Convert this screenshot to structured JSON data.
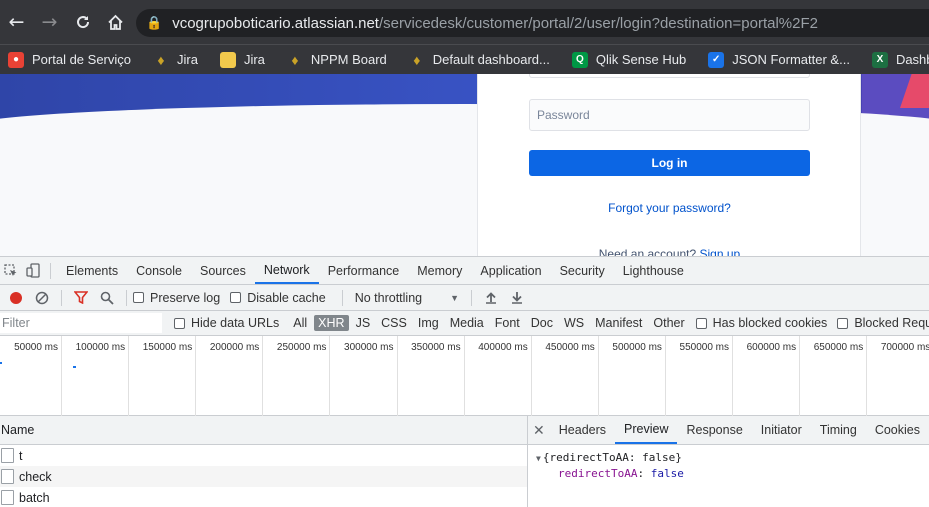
{
  "browser": {
    "url_host": "vcogrupoboticario.atlassian.net",
    "url_path": "/servicedesk/customer/portal/2/user/login?destination=portal%2F2"
  },
  "bookmarks": [
    {
      "label": "Portal de Serviço",
      "icon": "portal-icon",
      "color": "#e94235"
    },
    {
      "label": "Jira",
      "icon": "jira-icon",
      "color": "#c9a227"
    },
    {
      "label": "Jira",
      "icon": "folder-icon",
      "color": "#f2c94c"
    },
    {
      "label": "NPPM Board",
      "icon": "jira-icon",
      "color": "#c9a227"
    },
    {
      "label": "Default dashboard...",
      "icon": "jira-icon",
      "color": "#c9a227"
    },
    {
      "label": "Qlik Sense Hub",
      "icon": "qlik-icon",
      "color": "#009845"
    },
    {
      "label": "JSON Formatter &...",
      "icon": "check-icon",
      "color": "#1a73e8"
    },
    {
      "label": "Dashboard Realizad...",
      "icon": "excel-icon",
      "color": "#1d6f42"
    }
  ],
  "login": {
    "password_placeholder": "Password",
    "login_button": "Log in",
    "forgot_link": "Forgot your password?",
    "signup_prompt": "Need an account?",
    "signup_link": "Sign up"
  },
  "devtools": {
    "tabs": [
      "Elements",
      "Console",
      "Sources",
      "Network",
      "Performance",
      "Memory",
      "Application",
      "Security",
      "Lighthouse"
    ],
    "active_tab": "Network",
    "toolbar": {
      "preserve_log": "Preserve log",
      "disable_cache": "Disable cache",
      "throttling": "No throttling"
    },
    "filter": {
      "placeholder": "Filter",
      "hide_data_urls": "Hide data URLs",
      "types": [
        "All",
        "XHR",
        "JS",
        "CSS",
        "Img",
        "Media",
        "Font",
        "Doc",
        "WS",
        "Manifest",
        "Other"
      ],
      "active_type": "XHR",
      "has_blocked_cookies": "Has blocked cookies",
      "blocked_requests": "Blocked Requests"
    },
    "timeline_ticks": [
      "50000 ms",
      "100000 ms",
      "150000 ms",
      "200000 ms",
      "250000 ms",
      "300000 ms",
      "350000 ms",
      "400000 ms",
      "450000 ms",
      "500000 ms",
      "550000 ms",
      "600000 ms",
      "650000 ms",
      "700000 ms"
    ],
    "requests": {
      "header": "Name",
      "rows": [
        "t",
        "check",
        "batch"
      ]
    },
    "detail": {
      "tabs": [
        "Headers",
        "Preview",
        "Response",
        "Initiator",
        "Timing",
        "Cookies"
      ],
      "active_tab": "Preview",
      "preview_summary": "{redirectToAA: false}",
      "preview_key": "redirectToAA",
      "preview_value": "false"
    }
  }
}
